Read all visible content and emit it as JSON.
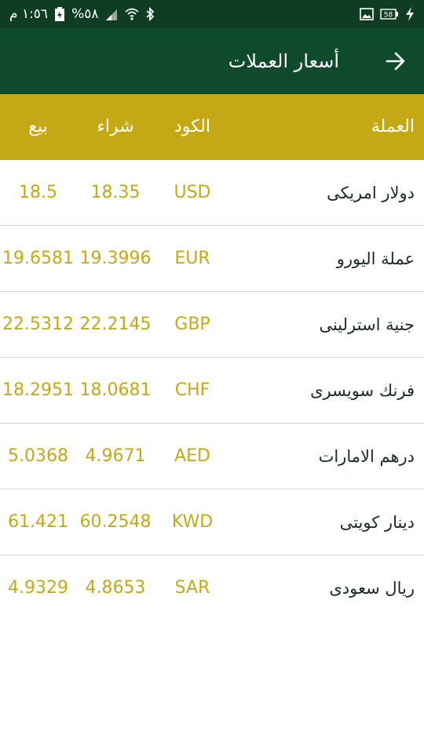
{
  "status_bar": {
    "time": "١:٥٦ م",
    "battery_percent": "%٥٨",
    "battery_badge": "58"
  },
  "app_bar": {
    "title": "أسعار العملات"
  },
  "table": {
    "headers": {
      "name": "العملة",
      "code": "الكود",
      "buy": "شراء",
      "sell": "بيع"
    },
    "rows": [
      {
        "name": "دولار امريكى",
        "code": "USD",
        "buy": "18.35",
        "sell": "18.5"
      },
      {
        "name": "عملة اليورو",
        "code": "EUR",
        "buy": "19.3996",
        "sell": "19.6581"
      },
      {
        "name": "جنية استرلينى",
        "code": "GBP",
        "buy": "22.2145",
        "sell": "22.5312"
      },
      {
        "name": "فرنك سويسرى",
        "code": "CHF",
        "buy": "18.0681",
        "sell": "18.2951"
      },
      {
        "name": "درهم الامارات",
        "code": "AED",
        "buy": "4.9671",
        "sell": "5.0368"
      },
      {
        "name": "دينار كويتى",
        "code": "KWD",
        "buy": "60.2548",
        "sell": "61.421"
      },
      {
        "name": "ريال سعودى",
        "code": "SAR",
        "buy": "4.8653",
        "sell": "4.9329"
      }
    ]
  },
  "colors": {
    "status_bar_bg": "#0f3d24",
    "app_bar_bg": "#0f4a2c",
    "header_bg": "#c5a815",
    "value_text": "#c5a815"
  }
}
